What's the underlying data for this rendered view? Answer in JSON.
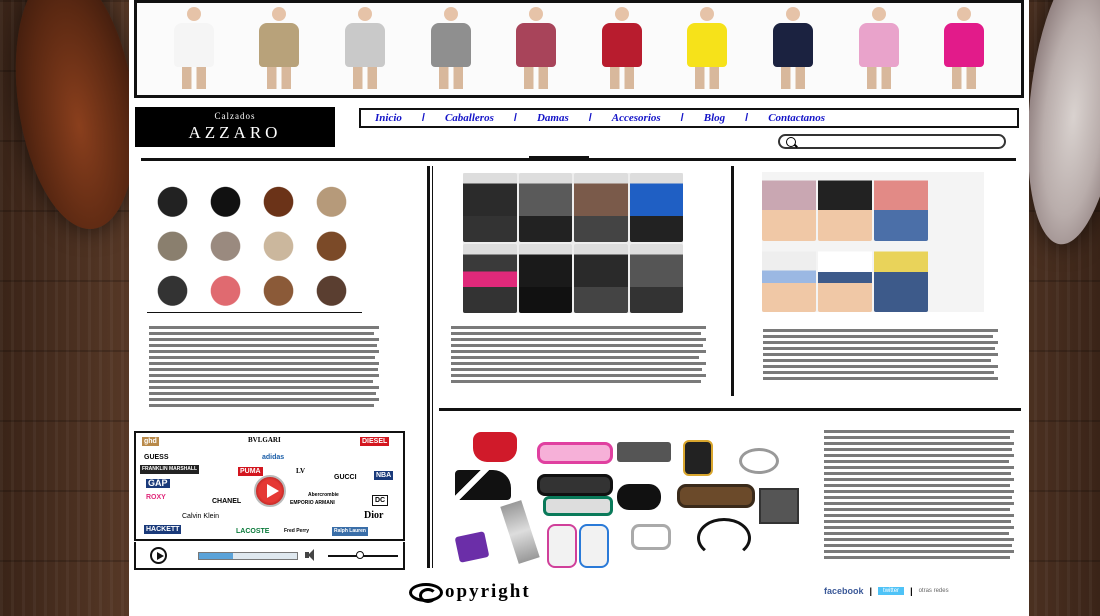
{
  "brand": {
    "small": "Calzados",
    "name": "AZZARO"
  },
  "nav": {
    "items": [
      "Inicio",
      "Caballeros",
      "Damas",
      "Accesorios",
      "Blog",
      "Contactanos"
    ],
    "separator": "/"
  },
  "search": {
    "placeholder": "",
    "value": ""
  },
  "banner": {
    "outfit_colors": [
      "#f5f5f5",
      "#b8a27a",
      "#c9c9c9",
      "#8f8f8f",
      "#a8445a",
      "#b81c2e",
      "#f6e21a",
      "#1b2240",
      "#e9a3cb",
      "#e21b8a"
    ]
  },
  "brands": {
    "logos": [
      "ghd",
      "BVLGARI",
      "DIESEL",
      "GUESS",
      "adidas",
      "FRANKLIN MARSHALL",
      "PUMA",
      "LV",
      "GUCCI",
      "GAP",
      "Abercrombie",
      "NBA",
      "ROXY",
      "CHANEL",
      "EMPORIO ARMANI",
      "DC",
      "Calvin Klein",
      "Dior",
      "HACKETT",
      "LACOSTE",
      "Fred Perry",
      "Ralph Lauren"
    ]
  },
  "player": {
    "progress": 0.35,
    "volume": 0.45
  },
  "footer": {
    "copyright": "opyright",
    "social": [
      "facebook",
      "twitter",
      "otras redes"
    ]
  },
  "colors": {
    "nav_link": "#1414c8",
    "logo_bg": "#000000",
    "page_bg": "#ffffff"
  }
}
